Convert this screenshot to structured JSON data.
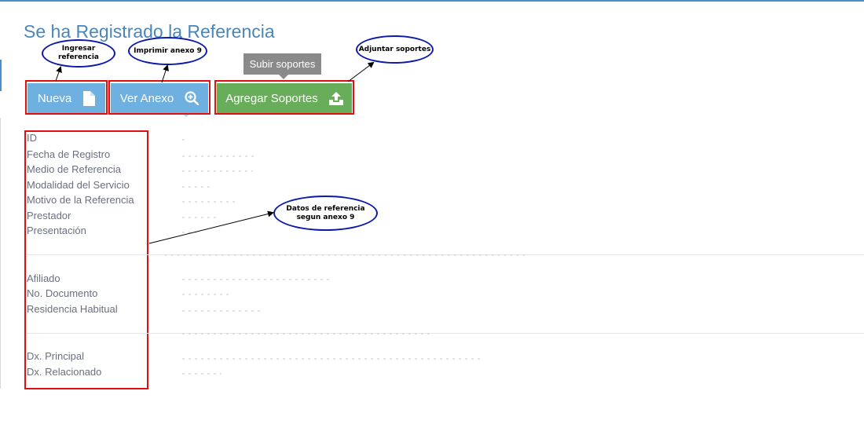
{
  "page": {
    "title": "Se ha Registrado la Referencia"
  },
  "toolbar": {
    "new_label": "Nueva",
    "annex_label": "Ver Anexo",
    "supports_label": "Agregar Soportes",
    "supports_tooltip": "Subir soportes",
    "icons": {
      "new": "document-icon",
      "annex": "zoom-in-icon",
      "supports": "upload-icon"
    }
  },
  "callouts": {
    "ingresar": "Ingresar\nreferencia",
    "imprimir": "Imprimir anexo 9",
    "adjuntar": "Adjuntar soportes",
    "datos": "Datos de referencia\nsegun anexo 9"
  },
  "fields": {
    "group1": [
      "ID",
      "Fecha de Registro",
      "Medio de Referencia",
      "Modalidad del Servicio",
      "Motivo de la Referencia",
      "Prestador",
      "Presentación"
    ],
    "group2": [
      "Afiliado",
      "No. Documento",
      "Residencia Habitual"
    ],
    "group3": [
      "Dx. Principal",
      "Dx. Relacionado"
    ]
  },
  "colors": {
    "title": "#4a86b8",
    "button_blue": "#6eb0e0",
    "button_green": "#68ad5a",
    "annotation_red": "#e01010",
    "callout_border": "#0b1aa8"
  }
}
